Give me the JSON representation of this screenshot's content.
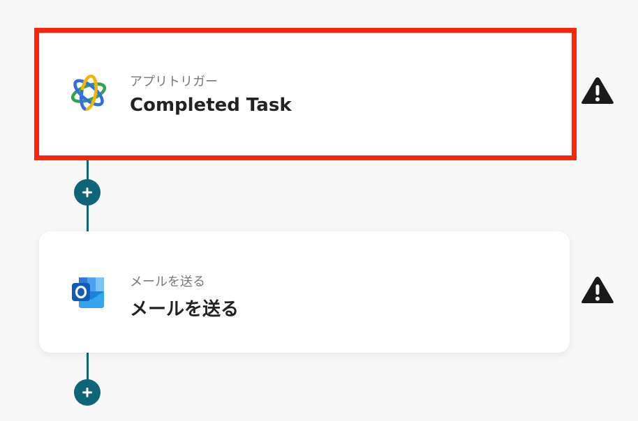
{
  "flow": {
    "steps": [
      {
        "app": "Completed Task trigger app",
        "icon": "orbit-app-icon",
        "sub_label": "アプリトリガー",
        "title": "Completed Task",
        "selected": true,
        "warning": true
      },
      {
        "app": "Outlook",
        "icon": "outlook-icon",
        "sub_label": "メールを送る",
        "title": "メールを送る",
        "selected": false,
        "warning": true
      }
    ],
    "add_step_buttons": 2
  },
  "colors": {
    "background": "#f7f7f7",
    "connector": "#0f6578",
    "selection_border": "#ff230a",
    "warning": "#1a1a1a"
  }
}
